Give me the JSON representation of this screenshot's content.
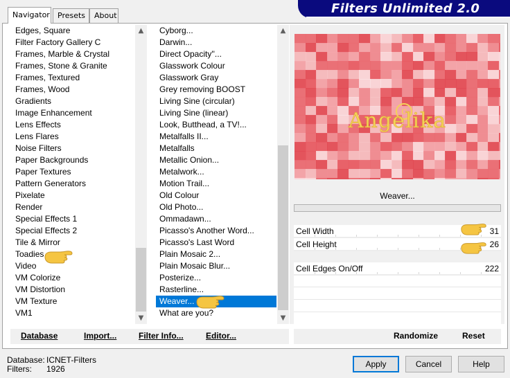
{
  "tabs": [
    {
      "label": "Navigator",
      "active": true
    },
    {
      "label": "Presets",
      "active": false
    },
    {
      "label": "About",
      "active": false
    }
  ],
  "banner": {
    "title": "Filters Unlimited 2.0"
  },
  "categories": {
    "items": [
      "Edges, Square",
      "Filter Factory Gallery C",
      "Frames, Marble & Crystal",
      "Frames, Stone & Granite",
      "Frames, Textured",
      "Frames, Wood",
      "Gradients",
      "Image Enhancement",
      "Lens Effects",
      "Lens Flares",
      "Noise Filters",
      "Paper Backgrounds",
      "Paper Textures",
      "Pattern Generators",
      "Pixelate",
      "Render",
      "Special Effects 1",
      "Special Effects 2",
      "Tile & Mirror",
      "Toadies",
      "Video",
      "VM Colorize",
      "VM Distortion",
      "VM Texture",
      "VM1"
    ]
  },
  "filters": {
    "items": [
      "Cyborg...",
      "Darwin...",
      "Direct Opacity''...",
      "Glasswork Colour",
      "Glasswork Gray",
      "Grey removing BOOST",
      "Living Sine (circular)",
      "Living Sine (linear)",
      "Look, Butthead, a TV!...",
      "Metalfalls II...",
      "Metalfalls",
      "Metallic Onion...",
      "Metalwork...",
      "Motion Trail...",
      "Old Colour",
      "Old Photo...",
      "Ommadawn...",
      "Picasso's Another Word...",
      "Picasso's Last Word",
      "Plain Mosaic 2...",
      "Plain Mosaic Blur...",
      "Posterize...",
      "Rasterline...",
      "Weaver...",
      "What are you?"
    ],
    "selected_index": 23
  },
  "preview": {
    "watermark": "Angelika"
  },
  "current_filter": "Weaver...",
  "params": [
    {
      "label": "Cell Width",
      "value": "31",
      "level": 31
    },
    {
      "label": "Cell Height",
      "value": "26",
      "level": 26
    },
    {
      "label": "Cell Edges On/Off",
      "value": "222",
      "level": 222
    }
  ],
  "left_buttons": {
    "database": "Database",
    "import": "Import...",
    "filter_info": "Filter Info...",
    "editor": "Editor..."
  },
  "right_buttons": {
    "randomize": "Randomize",
    "reset": "Reset"
  },
  "status": {
    "database_label": "Database:",
    "database_value": "ICNET-Filters",
    "filters_label": "Filters:",
    "filters_value": "1926"
  },
  "dialog_buttons": {
    "apply": "Apply",
    "cancel": "Cancel",
    "help": "Help"
  },
  "colors": {
    "accent": "#0078d7",
    "banner": "#0a0a7e",
    "pointer_hand": "#f5c542"
  },
  "icons": {
    "scroll_up": "▲",
    "scroll_down": "▼"
  }
}
